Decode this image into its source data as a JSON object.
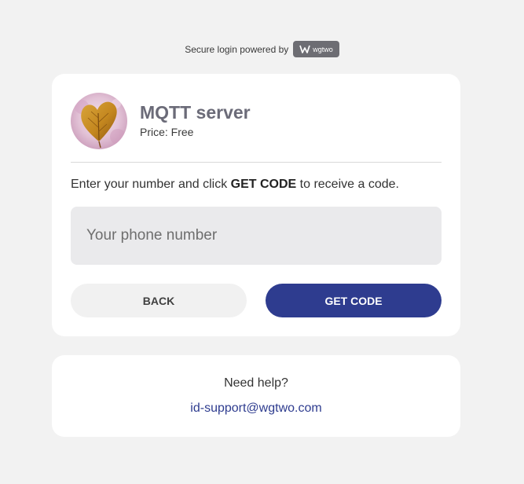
{
  "header": {
    "powered_by_text": "Secure login powered by",
    "brand_name": "wgtwo"
  },
  "service": {
    "avatar_icon": "autumn-leaf-heart-icon",
    "name": "MQTT server",
    "price": "Price: Free"
  },
  "login": {
    "instruction_prefix": "Enter your number and click ",
    "instruction_action": "GET CODE",
    "instruction_suffix": " to receive a code.",
    "phone_value": "",
    "phone_placeholder": "Your phone number",
    "back_label": "BACK",
    "get_code_label": "GET CODE"
  },
  "help": {
    "title": "Need help?",
    "email": "id-support@wgtwo.com"
  },
  "colors": {
    "page_background": "#f2f2f2",
    "card_background": "#ffffff",
    "accent": "#2e3c8f",
    "input_background": "#eaeaec",
    "badge_background": "#6d6d73"
  }
}
